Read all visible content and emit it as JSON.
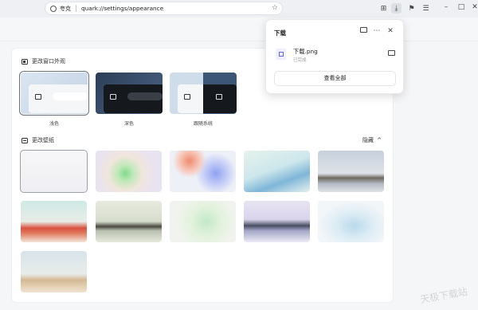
{
  "toolbar": {
    "site_label": "夸克",
    "url": "quark://settings/appearance",
    "icons": [
      "shield-icon",
      "star-icon",
      "grid-icon",
      "download-icon",
      "bookmark-icon",
      "menu-icon",
      "minimize-icon",
      "maximize-icon",
      "close-icon"
    ]
  },
  "appearance": {
    "title": "更改窗口外观",
    "themes": [
      {
        "label": "浅色",
        "selected": true
      },
      {
        "label": "深色",
        "selected": false
      },
      {
        "label": "跟随系统",
        "selected": false
      }
    ]
  },
  "wallpaper": {
    "title": "更改壁纸",
    "hide_label": "隐藏",
    "chevron": "^",
    "count": 11,
    "selected_index": 0
  },
  "downloads": {
    "title": "下载",
    "file_name": "下载.png",
    "file_status": "已完成",
    "view_all": "查看全部"
  },
  "watermark": "天极下载站",
  "colors": {
    "accent": "#6b63d8",
    "dark_theme": "#0f1216",
    "light_theme": "#c9d6e6"
  }
}
